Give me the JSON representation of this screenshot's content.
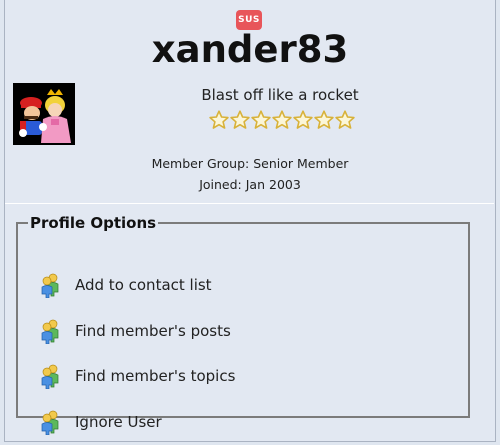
{
  "badge": "SUS",
  "username": "xander83",
  "tagline": "Blast off like a rocket",
  "rating": {
    "stars": 7,
    "icon": "star-icon"
  },
  "member_group": "Member Group: Senior Member",
  "joined": "Joined: Jan 2003",
  "profile_options": {
    "title": "Profile Options",
    "items": [
      {
        "label": "Add to contact list",
        "icon": "users-icon"
      },
      {
        "label": "Find member's posts",
        "icon": "users-icon"
      },
      {
        "label": "Find member's topics",
        "icon": "users-icon"
      },
      {
        "label": "Ignore User",
        "icon": "users-icon"
      }
    ]
  }
}
